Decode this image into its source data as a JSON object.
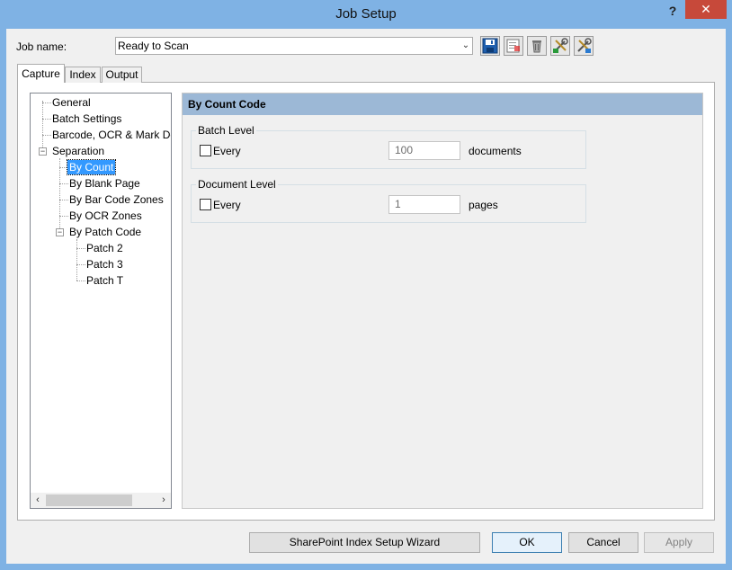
{
  "window": {
    "title": "Job Setup",
    "help_label": "?",
    "close_label": "✕"
  },
  "job": {
    "label": "Job name:",
    "value": "Ready to Scan",
    "dropdown_arrow": "⌄"
  },
  "toolbar": {
    "icons": [
      "save-icon",
      "properties-icon",
      "delete-icon",
      "run-icon",
      "settings-icon"
    ]
  },
  "tabs": [
    {
      "label": "Capture",
      "active": true
    },
    {
      "label": "Index",
      "active": false
    },
    {
      "label": "Output",
      "active": false
    }
  ],
  "tree": {
    "items": [
      {
        "label": "General"
      },
      {
        "label": "Batch Settings"
      },
      {
        "label": "Barcode, OCR & Mark De"
      },
      {
        "label": "Separation",
        "expander": "−"
      },
      {
        "label": "By Count",
        "selected": true
      },
      {
        "label": "By Blank Page"
      },
      {
        "label": "By Bar Code Zones"
      },
      {
        "label": "By OCR Zones"
      },
      {
        "label": "By Patch Code",
        "expander": "−"
      },
      {
        "label": "Patch 2"
      },
      {
        "label": "Patch 3"
      },
      {
        "label": "Patch T"
      }
    ],
    "scroll_left": "‹",
    "scroll_right": "›"
  },
  "panel": {
    "title": "By Count Code",
    "batch_level": {
      "label": "Batch Level",
      "checkbox_label": "Every",
      "value": "100",
      "unit": "documents"
    },
    "document_level": {
      "label": "Document Level",
      "checkbox_label": "Every",
      "value": "1",
      "unit": "pages"
    }
  },
  "buttons": {
    "wizard": "SharePoint Index Setup Wizard",
    "ok": "OK",
    "cancel": "Cancel",
    "apply": "Apply"
  },
  "colors": {
    "titlebar": "#7fb2e4",
    "selection": "#3399ff",
    "header": "#9cb8d6",
    "close": "#c7493a"
  }
}
